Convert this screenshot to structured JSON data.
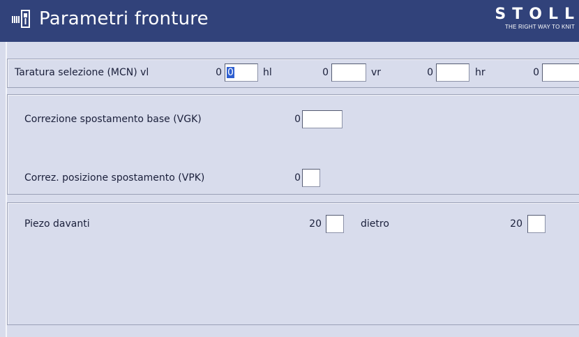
{
  "header": {
    "title": "Parametri fronture",
    "brand": "STOLL",
    "tagline": "THE RIGHT WAY TO KNIT"
  },
  "taratura": {
    "label": "Taratura selezione (MCN) vl",
    "vl_value": "0",
    "vl_input": "0",
    "hl_label": "hl",
    "hl_value": "0",
    "vr_label": "vr",
    "vr_value": "0",
    "hr_label": "hr",
    "hr_value": "0"
  },
  "correzione": {
    "vgk_label": "Correzione spostamento base (VGK)",
    "vgk_value": "0",
    "vpk_label": "Correz. posizione spostamento (VPK)",
    "vpk_value": "0"
  },
  "piezo": {
    "davanti_label": "Piezo davanti",
    "davanti_value": "20",
    "dietro_label": "dietro",
    "dietro_value": "20"
  },
  "colors": {
    "titlebar": "#31427a",
    "background": "#d8dcec",
    "selection": "#2f5fd0"
  }
}
